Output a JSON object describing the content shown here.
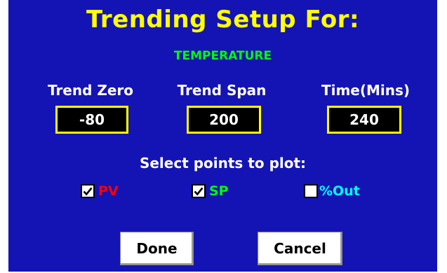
{
  "title": "Trending Setup For:",
  "point_name": "TEMPERATURE",
  "fields": {
    "trend_zero": {
      "label": "Trend Zero",
      "value": "-80"
    },
    "trend_span": {
      "label": "Trend Span",
      "value": "200"
    },
    "time": {
      "label": "Time(Mins)",
      "value": "240"
    }
  },
  "select_label": "Select points to plot:",
  "points": [
    {
      "label": "PV",
      "checked": true,
      "color": "#ff0000"
    },
    {
      "label": "SP",
      "checked": true,
      "color": "#00ff00"
    },
    {
      "label": "%Out",
      "checked": false,
      "color": "#00ffff"
    }
  ],
  "buttons": {
    "done": "Done",
    "cancel": "Cancel"
  },
  "colors": {
    "background": "#1414b4",
    "title": "#ffff00",
    "point_name": "#00ff00",
    "field_border": "#ffff00"
  }
}
